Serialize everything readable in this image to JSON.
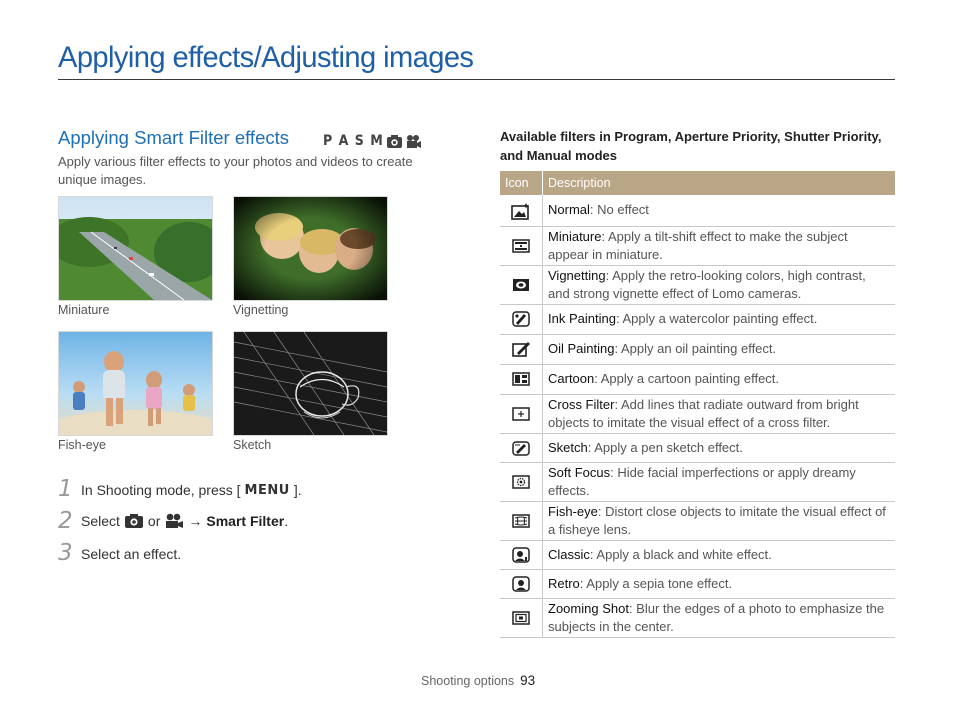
{
  "header": {
    "title": "Applying effects/Adjusting images"
  },
  "section": {
    "heading": "Applying Smart Filter effects",
    "mode_letters": "P A S M",
    "mode_icons": [
      "smart-auto-icon",
      "movie-icon"
    ],
    "intro": "Apply various filter effects to your photos and videos to create unique images."
  },
  "samples": [
    {
      "caption": "Miniature",
      "icon": "miniature-sample"
    },
    {
      "caption": "Vignetting",
      "icon": "vignetting-sample"
    },
    {
      "caption": "Fish-eye",
      "icon": "fisheye-sample"
    },
    {
      "caption": "Sketch",
      "icon": "sketch-sample"
    }
  ],
  "steps": [
    {
      "num": "1",
      "pre": "In Shooting mode, press [",
      "key": "MENU",
      "post": "]."
    },
    {
      "num": "2",
      "pre": "Select",
      "mid": "or",
      "arrow": "→",
      "bold": "Smart Filter",
      "post": "."
    },
    {
      "num": "3",
      "text": "Select an effect."
    }
  ],
  "table": {
    "heading": "Available filters in Program, Aperture Priority, Shutter Priority, and Manual modes",
    "columns": [
      "Icon",
      "Description"
    ],
    "rows": [
      {
        "icon": "normal-filter-icon",
        "name": "Normal",
        "desc": ": No effect"
      },
      {
        "icon": "miniature-filter-icon",
        "name": "Miniature",
        "desc": ": Apply a tilt-shift effect to make the subject appear in miniature."
      },
      {
        "icon": "vignetting-filter-icon",
        "name": "Vignetting",
        "desc": ": Apply the retro-looking colors, high contrast, and strong vignette effect of Lomo cameras."
      },
      {
        "icon": "ink-painting-filter-icon",
        "name": "Ink Painting",
        "desc": ": Apply a watercolor painting effect."
      },
      {
        "icon": "oil-painting-filter-icon",
        "name": "Oil Painting",
        "desc": ": Apply an oil painting effect."
      },
      {
        "icon": "cartoon-filter-icon",
        "name": "Cartoon",
        "desc": ": Apply a cartoon painting effect."
      },
      {
        "icon": "cross-filter-icon",
        "name": "Cross Filter",
        "desc": ": Add lines that radiate outward from bright objects to imitate the visual effect of a cross filter."
      },
      {
        "icon": "sketch-filter-icon",
        "name": "Sketch",
        "desc": ": Apply a pen sketch effect."
      },
      {
        "icon": "soft-focus-filter-icon",
        "name": "Soft Focus",
        "desc": ": Hide facial imperfections or apply dreamy effects."
      },
      {
        "icon": "fisheye-filter-icon",
        "name": "Fish-eye",
        "desc": ": Distort close objects to imitate the visual effect of a fisheye lens."
      },
      {
        "icon": "classic-filter-icon",
        "name": "Classic",
        "desc": ": Apply a black and white effect."
      },
      {
        "icon": "retro-filter-icon",
        "name": "Retro",
        "desc": ": Apply a sepia tone effect."
      },
      {
        "icon": "zooming-shot-filter-icon",
        "name": "Zooming Shot",
        "desc": ": Blur the edges of a photo to emphasize the subjects in the center."
      }
    ]
  },
  "footer": {
    "section": "Shooting options",
    "page": "93"
  },
  "colors": {
    "title": "#1f5fa8",
    "heading": "#1f6fb6",
    "table_header": "#b9a687"
  }
}
